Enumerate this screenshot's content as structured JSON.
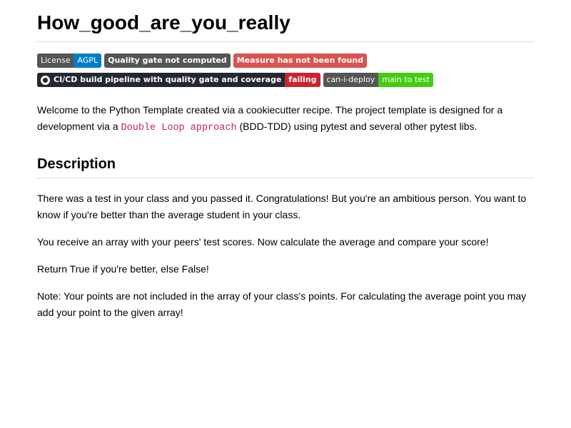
{
  "title": "How_good_are_you_really",
  "badges_row1": [
    {
      "left": "License",
      "right": "AGPL"
    },
    {
      "text": "Quality gate not computed"
    },
    {
      "text": "Measure has not been found"
    }
  ],
  "badges_row2": [
    {
      "left": "CI/CD build pipeline with quality gate and coverage",
      "right": "failing",
      "icon": "github-icon"
    },
    {
      "left": "can-i-deploy",
      "right": "main to test"
    }
  ],
  "intro": {
    "before": "Welcome to the Python Template created via a cookiecutter recipe. The project template is designed for a development via a ",
    "code": "Double Loop approach",
    "after": " (BDD-TDD) using pytest and several other pytest libs."
  },
  "description": {
    "heading": "Description",
    "paragraphs": [
      "There was a test in your class and you passed it. Congratulations! But you're an ambitious person. You want to know if you're better than the average student in your class.",
      "You receive an array with your peers' test scores. Now calculate the average and compare your score!",
      "Return True if you're better, else False!",
      "Note: Your points are not included in the array of your class's points. For calculating the average point you may add your point to the given array!"
    ]
  },
  "colors": {
    "license_right": "#007ec6",
    "quality_gate": "#555555",
    "measure": "#d9534f",
    "failing": "#cb2431",
    "deploy_right": "#44cc11",
    "code": "#c7254e"
  }
}
